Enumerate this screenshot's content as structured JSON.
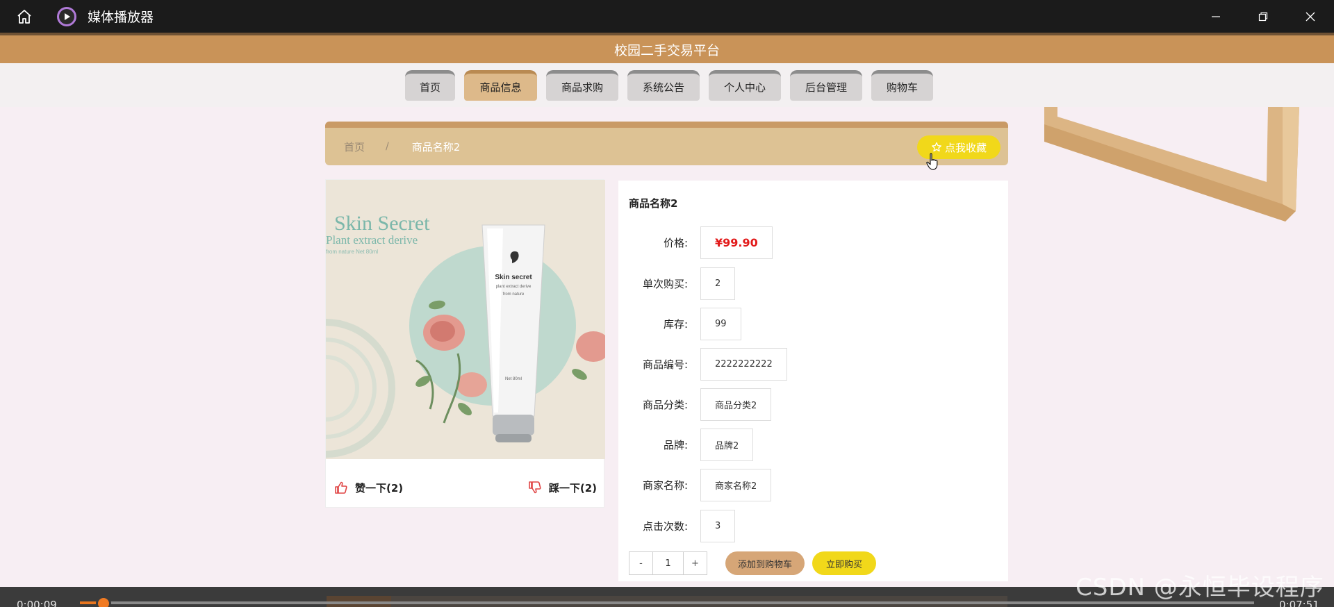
{
  "window": {
    "title": "媒体播放器"
  },
  "app": {
    "title": "校园二手交易平台"
  },
  "nav": {
    "items": [
      {
        "label": "首页"
      },
      {
        "label": "商品信息"
      },
      {
        "label": "商品求购"
      },
      {
        "label": "系统公告"
      },
      {
        "label": "个人中心"
      },
      {
        "label": "后台管理"
      },
      {
        "label": "购物车"
      }
    ]
  },
  "breadcrumb": {
    "home": "首页",
    "separator": "/",
    "current": "商品名称2",
    "favorite": "点我收藏"
  },
  "product": {
    "image": {
      "brand_text": "Skin Secret",
      "sub_text": "Plant extract derive",
      "small_text": "from nature Net 80ml",
      "tube_brand": "Skin secret",
      "tube_sub": "plant extract derive",
      "tube_from": "from nature",
      "tube_net": "Net 80ml"
    },
    "like_label": "赞一下(2)",
    "dislike_label": "踩一下(2)",
    "name": "商品名称2",
    "fields": [
      {
        "label": "价格:",
        "value": "¥99.90"
      },
      {
        "label": "单次购买:",
        "value": "2"
      },
      {
        "label": "库存:",
        "value": "99"
      },
      {
        "label": "商品编号:",
        "value": "2222222222"
      },
      {
        "label": "商品分类:",
        "value": "商品分类2"
      },
      {
        "label": "品牌:",
        "value": "品牌2"
      },
      {
        "label": "商家名称:",
        "value": "商家名称2"
      },
      {
        "label": "点击次数:",
        "value": "3"
      }
    ],
    "quantity": {
      "minus": "-",
      "value": "1",
      "plus": "+"
    },
    "add_to_cart": "添加到购物车",
    "buy_now": "立即购买"
  },
  "player": {
    "current_time": "0:00:09",
    "total_time": "0:07:51",
    "progress": 0.02
  },
  "watermark": "CSDN @永恒毕设程序"
}
